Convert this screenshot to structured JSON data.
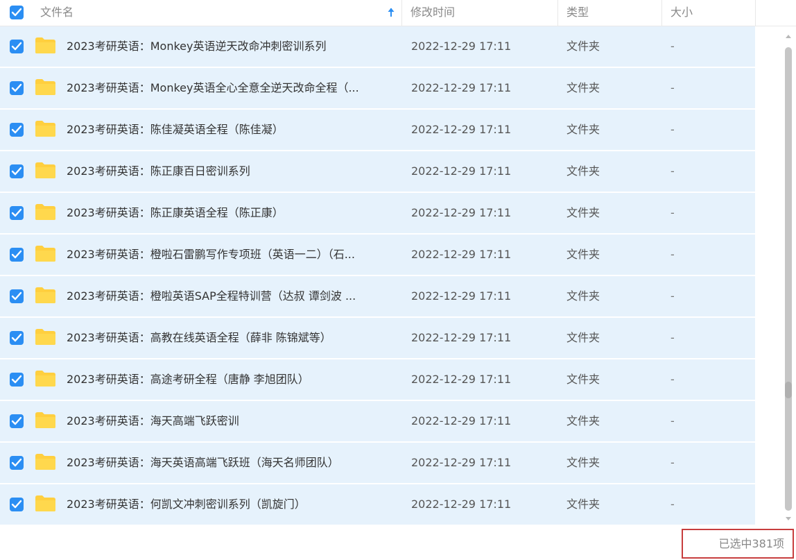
{
  "header": {
    "name_label": "文件名",
    "time_label": "修改时间",
    "type_label": "类型",
    "size_label": "大小",
    "select_all_checked": true,
    "sort_direction": "ascending"
  },
  "rows": [
    {
      "name": "2023考研英语：Monkey英语逆天改命冲刺密训系列",
      "time": "2022-12-29 17:11",
      "type": "文件夹",
      "size": "-",
      "checked": true
    },
    {
      "name": "2023考研英语：Monkey英语全心全意全逆天改命全程（...",
      "time": "2022-12-29 17:11",
      "type": "文件夹",
      "size": "-",
      "checked": true
    },
    {
      "name": "2023考研英语：陈佳凝英语全程（陈佳凝）",
      "time": "2022-12-29 17:11",
      "type": "文件夹",
      "size": "-",
      "checked": true
    },
    {
      "name": "2023考研英语：陈正康百日密训系列",
      "time": "2022-12-29 17:11",
      "type": "文件夹",
      "size": "-",
      "checked": true
    },
    {
      "name": "2023考研英语：陈正康英语全程（陈正康）",
      "time": "2022-12-29 17:11",
      "type": "文件夹",
      "size": "-",
      "checked": true
    },
    {
      "name": "2023考研英语：橙啦石雷鹏写作专项班（英语一二）（石...",
      "time": "2022-12-29 17:11",
      "type": "文件夹",
      "size": "-",
      "checked": true
    },
    {
      "name": "2023考研英语：橙啦英语SAP全程特训营（达叔 谭剑波 ...",
      "time": "2022-12-29 17:11",
      "type": "文件夹",
      "size": "-",
      "checked": true
    },
    {
      "name": "2023考研英语：高教在线英语全程（薛非 陈锦斌等）",
      "time": "2022-12-29 17:11",
      "type": "文件夹",
      "size": "-",
      "checked": true
    },
    {
      "name": "2023考研英语：高途考研全程（唐静 李旭团队）",
      "time": "2022-12-29 17:11",
      "type": "文件夹",
      "size": "-",
      "checked": true
    },
    {
      "name": "2023考研英语：海天高端飞跃密训",
      "time": "2022-12-29 17:11",
      "type": "文件夹",
      "size": "-",
      "checked": true
    },
    {
      "name": "2023考研英语：海天英语高端飞跃班（海天名师团队）",
      "time": "2022-12-29 17:11",
      "type": "文件夹",
      "size": "-",
      "checked": true
    },
    {
      "name": "2023考研英语：何凯文冲刺密训系列（凯旋门）",
      "time": "2022-12-29 17:11",
      "type": "文件夹",
      "size": "-",
      "checked": true
    }
  ],
  "status": {
    "selected_text": "已选中381项"
  },
  "colors": {
    "accent": "#2b8ef3",
    "row_selected_bg": "#e6f2fc",
    "folder": "#ffcf3f",
    "status_border": "#c73d3d"
  }
}
